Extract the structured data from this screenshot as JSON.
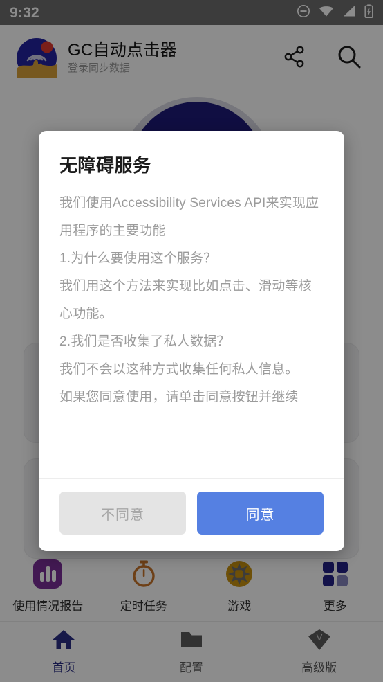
{
  "status_bar": {
    "time": "9:32",
    "icons": [
      "do-not-disturb-icon",
      "wifi-icon",
      "cellular-signal-icon",
      "battery-charging-icon"
    ]
  },
  "app_bar": {
    "logo_icon": "app-logo-icon",
    "title": "GC自动点击器",
    "subtitle": "登录同步数据",
    "share_icon": "share-icon",
    "search_icon": "search-icon"
  },
  "dialog": {
    "title": "无障碍服务",
    "message": "我们使用Accessibility Services API来实现应用程序的主要功能\n1.为什么要使用这个服务？\n我们用这个方法来实现比如点击、滑动等核心功能。\n2.我们是否收集了私人数据？\n我们不会以这种方式收集任何私人信息。\n如果您同意使用，请单击同意按钮并继续",
    "decline_label": "不同意",
    "accept_label": "同意",
    "accent_color": "#5580e2",
    "decline_color": "#e4e4e4"
  },
  "quick_actions": [
    {
      "label": "使用情况报告",
      "icon": "usage-report-icon",
      "color": "#7b2f98"
    },
    {
      "label": "定时任务",
      "icon": "timer-icon",
      "color": "#c8762a"
    },
    {
      "label": "游戏",
      "icon": "game-wheel-icon",
      "color": "#c8920f"
    },
    {
      "label": "更多",
      "icon": "more-grid-icon",
      "color": "#232287"
    }
  ],
  "bottom_nav": [
    {
      "label": "首页",
      "icon": "home-icon",
      "active": true,
      "color": "#2b2f86"
    },
    {
      "label": "配置",
      "icon": "folder-icon",
      "active": false,
      "color": "#5b5b5b"
    },
    {
      "label": "高级版",
      "icon": "premium-diamond-icon",
      "active": false,
      "color": "#5b5b5b"
    }
  ]
}
